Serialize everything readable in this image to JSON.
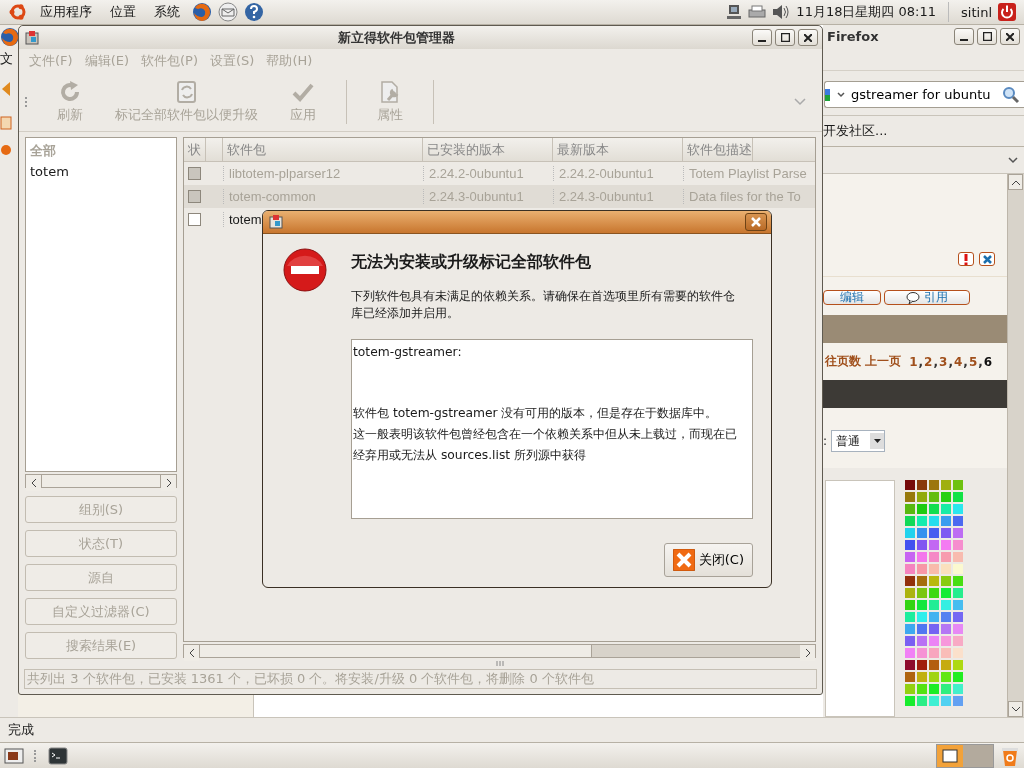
{
  "top_panel": {
    "menus": [
      "应用程序",
      "位置",
      "系统"
    ],
    "clock": "11月18日星期四 08:11",
    "user": "sitinl"
  },
  "firefox": {
    "title": "Firefox",
    "menu_partial": "文",
    "search": {
      "value": "gstreamer for ubuntu"
    },
    "bookmark": "开发社区...",
    "post_buttons": [
      "编辑",
      "引用"
    ],
    "pager": {
      "label": "往页数 上一页",
      "separator": ",",
      "pages": [
        {
          "label": "1",
          "selected": false
        },
        {
          "label": "2",
          "selected": false
        },
        {
          "label": "3",
          "selected": false
        },
        {
          "label": "4",
          "selected": false
        },
        {
          "label": "5",
          "selected": false
        },
        {
          "label": "6",
          "selected": true
        }
      ]
    },
    "select_label": ":",
    "select_value": "普通",
    "status": "完成"
  },
  "synaptic": {
    "title": "新立得软件包管理器",
    "menus": [
      {
        "label": "文件(F)",
        "disabled": true
      },
      {
        "label": "编辑(E)",
        "disabled": true
      },
      {
        "label": "软件包(P)",
        "disabled": true
      },
      {
        "label": "设置(S)",
        "disabled": true
      },
      {
        "label": "帮助(H)",
        "disabled": true
      }
    ],
    "toolbar": [
      {
        "label": "刷新",
        "kind": "refresh",
        "disabled": true
      },
      {
        "label": "标记全部软件包以便升级",
        "kind": "mark",
        "disabled": true
      },
      {
        "label": "应用",
        "kind": "apply",
        "disabled": true
      },
      {
        "label": "属性",
        "kind": "properties",
        "disabled": true
      }
    ],
    "filters": [
      {
        "label": "全部",
        "kind": "header"
      },
      {
        "label": "totem",
        "kind": "item"
      }
    ],
    "filter_buttons": [
      {
        "label": "组别(S)",
        "disabled": true
      },
      {
        "label": "状态(T)",
        "disabled": true
      },
      {
        "label": "源自",
        "disabled": true
      },
      {
        "label": "自定义过滤器(C)",
        "disabled": true
      },
      {
        "label": "搜索结果(E)",
        "disabled": true
      }
    ],
    "table": {
      "columns": [
        "状",
        "软件包",
        "已安装的版本",
        "最新版本",
        "软件包描述"
      ],
      "rows": [
        {
          "installed": true,
          "package": "libtotem-plparser12",
          "installed_version": "2.24.2-0ubuntu1",
          "latest_version": "2.24.2-0ubuntu1",
          "description": "Totem Playlist Parse"
        },
        {
          "installed": true,
          "package": "totem-common",
          "installed_version": "2.24.3-0ubuntu1",
          "latest_version": "2.24.3-0ubuntu1",
          "description": "Data files for the To"
        },
        {
          "installed": false,
          "package": "totem"
        }
      ]
    },
    "status": "共列出 3 个软件包，已安装 1361 个，已坏损 0 个。将安装/升级 0 个软件包，将删除 0 个软件包"
  },
  "dialog": {
    "heading": "无法为安装或升级标记全部软件包",
    "message": "下列软件包具有未满足的依赖关系。请确保在首选项里所有需要的软件仓库已经添加并启用。",
    "details": [
      "totem-gstreamer:",
      "软件包 totem-gstreamer 没有可用的版本，但是存在于数据库中。",
      "这一般表明该软件包曾经包含在一个依赖关系中但从未上载过，而现在已经弃用或无法从 sources.list 所列源中获得"
    ],
    "buttons": [
      {
        "label": "关闭(C)"
      }
    ]
  }
}
